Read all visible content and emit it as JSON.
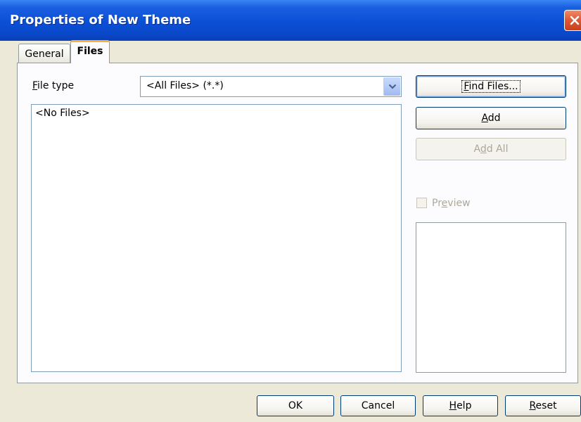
{
  "window": {
    "title": "Properties of New Theme"
  },
  "tabs": [
    {
      "label": "General",
      "selected": false
    },
    {
      "label": "Files",
      "selected": true
    }
  ],
  "file_type": {
    "label_mnemonic": "F",
    "label_rest": "ile type",
    "value": "<All Files> (*.*)"
  },
  "file_list": {
    "empty_text": "<No Files>"
  },
  "buttons": {
    "find_files_mnemonic": "F",
    "find_files_rest": "ind Files...",
    "add_mnemonic": "A",
    "add_rest": "dd",
    "add_all_pre": "A",
    "add_all_mnemonic": "d",
    "add_all_rest": "d All",
    "ok": "OK",
    "cancel": "Cancel",
    "help_mnemonic": "H",
    "help_rest": "elp",
    "reset_mnemonic": "R",
    "reset_rest": "eset"
  },
  "preview": {
    "label_pre": "Pr",
    "label_mnemonic": "e",
    "label_rest": "view",
    "checked": false,
    "enabled": false
  },
  "icons": {
    "close": "close-icon",
    "dropdown": "chevron-down-icon"
  },
  "colors": {
    "titlebar": "#0b4fd6",
    "selected_tab_accent": "#f6b33a",
    "close_button": "#e15a35",
    "dialog_background": "#ece9d8"
  }
}
